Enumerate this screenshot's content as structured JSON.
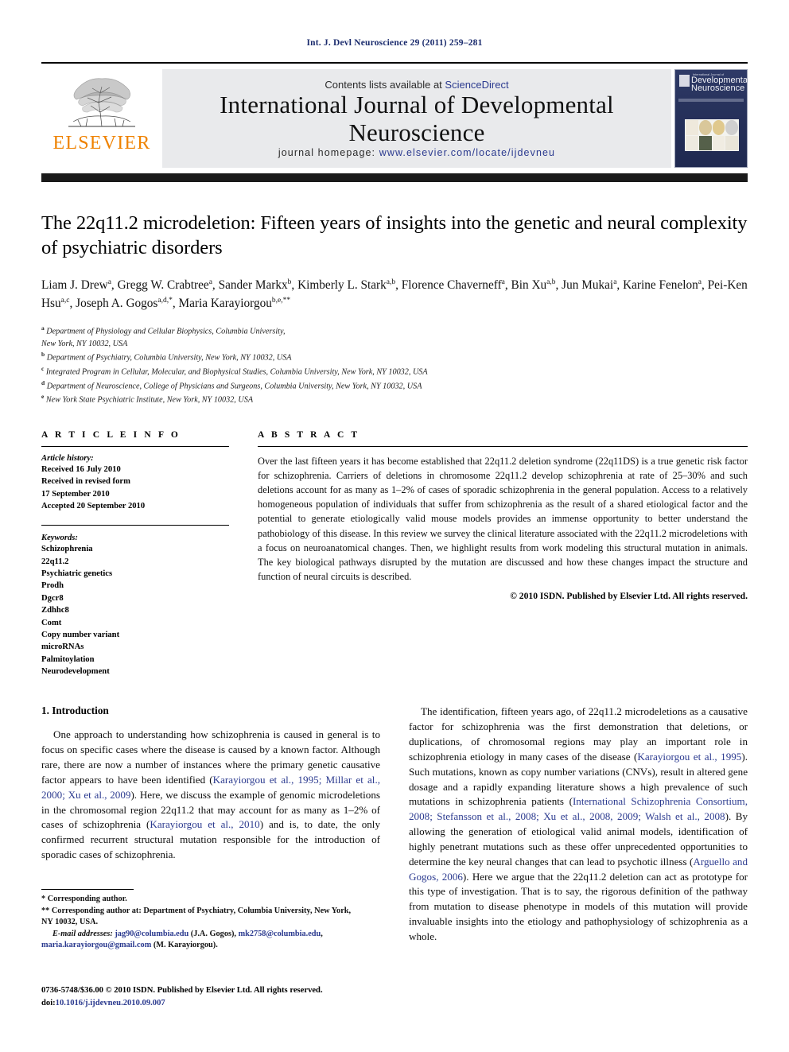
{
  "running_head": "Int. J. Devl Neuroscience 29 (2011) 259–281",
  "masthead": {
    "publisher": "ELSEVIER",
    "contents_prefix": "Contents lists available at ",
    "contents_link": "ScienceDirect",
    "journal_title": "International Journal of Developmental Neuroscience",
    "homepage_prefix": "journal homepage: ",
    "homepage_url": "www.elsevier.com/locate/ijdevneu",
    "cover": {
      "line1": "International Journal of",
      "line2": "Developmental",
      "line3": "Neuroscience"
    },
    "colors": {
      "elsevier_orange": "#ef8200",
      "link_blue": "#2b3a8f",
      "panel_gray": "#e9eaec"
    }
  },
  "article": {
    "title": "The 22q11.2 microdeletion: Fifteen years of insights into the genetic and neural complexity of psychiatric disorders",
    "authors": [
      {
        "name": "Liam J. Drew",
        "sup": "a",
        "sep": ", "
      },
      {
        "name": "Gregg W. Crabtree",
        "sup": "a",
        "sep": ", "
      },
      {
        "name": "Sander Markx",
        "sup": "b",
        "sep": ", "
      },
      {
        "name": "Kimberly L. Stark",
        "sup": "a,b",
        "sep": ", "
      },
      {
        "name": "Florence Chaverneff",
        "sup": "a",
        "sep": ", "
      },
      {
        "name": "Bin Xu",
        "sup": "a,b",
        "sep": ", "
      },
      {
        "name": "Jun Mukai",
        "sup": "a",
        "sep": ", "
      },
      {
        "name": "Karine Fenelon",
        "sup": "a",
        "sep": ", "
      },
      {
        "name": "Pei-Ken Hsu",
        "sup": "a,c",
        "sep": ", "
      },
      {
        "name": "Joseph A. Gogos",
        "sup": "a,d,*",
        "sep": ", "
      },
      {
        "name": "Maria Karayiorgou",
        "sup": "b,e,**",
        "sep": ""
      }
    ],
    "affiliations": [
      {
        "sup": "a",
        "text": "Department of Physiology and Cellular Biophysics, Columbia University,"
      },
      {
        "sup": "",
        "text": "New York, NY 10032, USA"
      },
      {
        "sup": "b",
        "text": "Department of Psychiatry, Columbia University, New York, NY 10032, USA"
      },
      {
        "sup": "c",
        "text": "Integrated Program in Cellular, Molecular, and Biophysical Studies, Columbia University, New York, NY 10032, USA"
      },
      {
        "sup": "d",
        "text": "Department of Neuroscience, College of Physicians and Surgeons, Columbia University, New York, NY 10032, USA"
      },
      {
        "sup": "e",
        "text": "New York State Psychiatric Institute, New York, NY 10032, USA"
      }
    ]
  },
  "article_info": {
    "heading": "A R T I C L E    I N F O",
    "history_title": "Article history:",
    "history_lines": [
      "Received 16 July 2010",
      "Received in revised form",
      "17 September 2010",
      "Accepted 20 September 2010"
    ],
    "keywords_title": "Keywords:",
    "keywords": [
      "Schizophrenia",
      "22q11.2",
      "Psychiatric genetics",
      "Prodh",
      "Dgcr8",
      "Zdhhc8",
      "Comt",
      "Copy number variant",
      "microRNAs",
      "Palmitoylation",
      "Neurodevelopment"
    ]
  },
  "abstract": {
    "heading": "A B S T R A C T",
    "text": "Over the last fifteen years it has become established that 22q11.2 deletion syndrome (22q11DS) is a true genetic risk factor for schizophrenia. Carriers of deletions in chromosome 22q11.2 develop schizophrenia at rate of 25–30% and such deletions account for as many as 1–2% of cases of sporadic schizophrenia in the general population. Access to a relatively homogeneous population of individuals that suffer from schizophrenia as the result of a shared etiological factor and the potential to generate etiologically valid mouse models provides an immense opportunity to better understand the pathobiology of this disease. In this review we survey the clinical literature associated with the 22q11.2 microdeletions with a focus on neuroanatomical changes. Then, we highlight results from work modeling this structural mutation in animals. The key biological pathways disrupted by the mutation are discussed and how these changes impact the structure and function of neural circuits is described.",
    "copyright": "© 2010 ISDN. Published by Elsevier Ltd. All rights reserved."
  },
  "body": {
    "section_number_title": "1.  Introduction",
    "left_paragraph": {
      "part1": "One approach to understanding how schizophrenia is caused in general is to focus on specific cases where the disease is caused by a known factor. Although rare, there are now a number of instances where the primary genetic causative factor appears to have been identified (",
      "cite1": "Karayiorgou et al., 1995; Millar et al., 2000; Xu et al., 2009",
      "part2": "). Here, we discuss the example of genomic microdeletions in the chromosomal region 22q11.2 that may account for as many as 1–2% of cases of schizophrenia (",
      "cite2": "Karayiorgou et al., 2010",
      "part3": ") and is, to date, the only confirmed recurrent structural mutation responsible for the introduction of sporadic cases of schizophrenia."
    },
    "right_paragraph": {
      "part1": "The identification, fifteen years ago, of 22q11.2 microdeletions as a causative factor for schizophrenia was the first demonstration that deletions, or duplications, of chromosomal regions may play an important role in schizophrenia etiology in many cases of the disease (",
      "cite1": "Karayiorgou et al., 1995",
      "part2": "). Such mutations, known as copy number variations (CNVs), result in altered gene dosage and a rapidly expanding literature shows a high prevalence of such mutations in schizophrenia patients (",
      "cite2": "International Schizophrenia Consortium, 2008; Stefansson et al., 2008; Xu et al., 2008, 2009; Walsh et al., 2008",
      "part3": "). By allowing the generation of etiological valid animal models, identification of highly penetrant mutations such as these offer unprecedented opportunities to determine the key neural changes that can lead to psychotic illness (",
      "cite3": "Arguello and Gogos, 2006",
      "part4": "). Here we argue that the 22q11.2 deletion can act as prototype for this type of investigation. That is to say, the rigorous definition of the pathway from mutation to disease phenotype in models of this mutation will provide invaluable insights into the etiology and pathophysiology of schizophrenia as a whole."
    }
  },
  "footnotes": {
    "star": "*  Corresponding author.",
    "doublestar": "**  Corresponding author at: Department of Psychiatry, Columbia University, New York, NY 10032, USA.",
    "email_label": "E-mail addresses:",
    "email1": "jag90@columbia.edu",
    "email1_owner": " (J.A. Gogos), ",
    "email2": "mk2758@columbia.edu",
    "email2_sep": ", ",
    "email3": "maria.karayiorgou@gmail.com",
    "email3_owner": " (M. Karayiorgou)."
  },
  "imprint": {
    "issn_line": "0736-5748/$36.00 © 2010 ISDN. Published by Elsevier Ltd. All rights reserved.",
    "doi_prefix": "doi:",
    "doi": "10.1016/j.ijdevneu.2010.09.007"
  }
}
